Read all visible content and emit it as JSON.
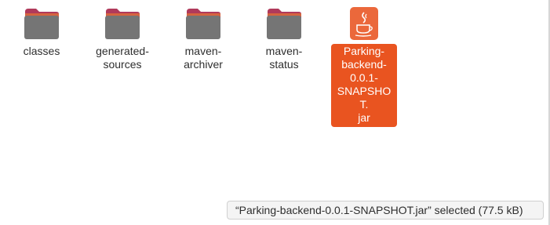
{
  "items": [
    {
      "label": "classes",
      "icon": "folder-icon"
    },
    {
      "label": "generated-\nsources",
      "icon": "folder-icon"
    },
    {
      "label": "maven-\narchiver",
      "icon": "folder-icon"
    },
    {
      "label": "maven-\nstatus",
      "icon": "folder-icon"
    },
    {
      "label": "Parking-\nbackend-\n0.0.1-\nSNAPSHOT.\njar",
      "icon": "java-jar-icon",
      "selected": true
    }
  ],
  "status": {
    "text": "“Parking-backend-0.0.1-SNAPSHOT.jar” selected  (77.5 kB)"
  },
  "colors": {
    "accent": "#e95420",
    "folder_tab": "#b03a5b",
    "folder_body": "#757575"
  }
}
